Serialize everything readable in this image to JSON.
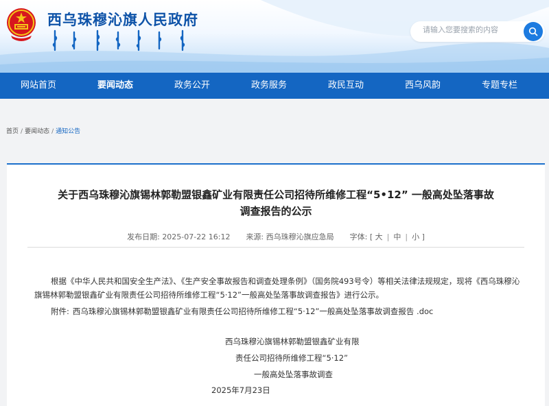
{
  "header": {
    "site_title": "西乌珠穆沁旗人民政府",
    "search_placeholder": "请输入您要搜索的内容"
  },
  "nav": {
    "items": [
      "网站首页",
      "要闻动态",
      "政务公开",
      "政务服务",
      "政民互动",
      "西乌风韵",
      "专题专栏"
    ],
    "active": "要闻动态"
  },
  "breadcrumb": [
    "首页",
    "要闻动态",
    "通知公告"
  ],
  "article": {
    "title_line1": "关于西乌珠穆沁旗锡林郭勒盟银鑫矿业有限责任公司招待所维修工程“5•12” 一般高处坠落事故",
    "title_line2": "调查报告的公示",
    "date_label": "发布日期:",
    "date": "2025-07-22 16:12",
    "source_label": "来源:",
    "source": "西乌珠穆沁旗应急局",
    "fontsize_label": "字体:",
    "fontsize_open": "[",
    "fontsize_large": "大",
    "fontsize_medium": "中",
    "fontsize_small": "小",
    "fontsize_close": "]",
    "paragraph1": "根据《中华人民共和国安全生产法》、《生产安全事故报告和调查处理条例》（国务院493号令）等相关法律法规规定，现将《西乌珠穆沁旗锡林郭勒盟银鑫矿业有限责任公司招待所维修工程“5·12”一般高处坠落事故调查报告》进行公示。",
    "attachment_label": "附件:",
    "attachment_name": "西乌珠穆沁旗锡林郭勒盟银鑫矿业有限责任公司招待所维修工程“5·12”一般高处坠落事故调查报告 .doc",
    "sign_line1": "西乌珠穆沁旗锡林郭勒盟银鑫矿业有限",
    "sign_line2": "责任公司招待所维修工程“5·12”",
    "sign_line3": "一般高处坠落事故调查",
    "sign_date": "2025年7月23日"
  },
  "colors": {
    "brand_blue": "#1466c2",
    "title_blue": "#0e53a8",
    "search_button": "#1d7be0"
  },
  "icons": [
    "national-emblem-icon",
    "search-icon"
  ]
}
